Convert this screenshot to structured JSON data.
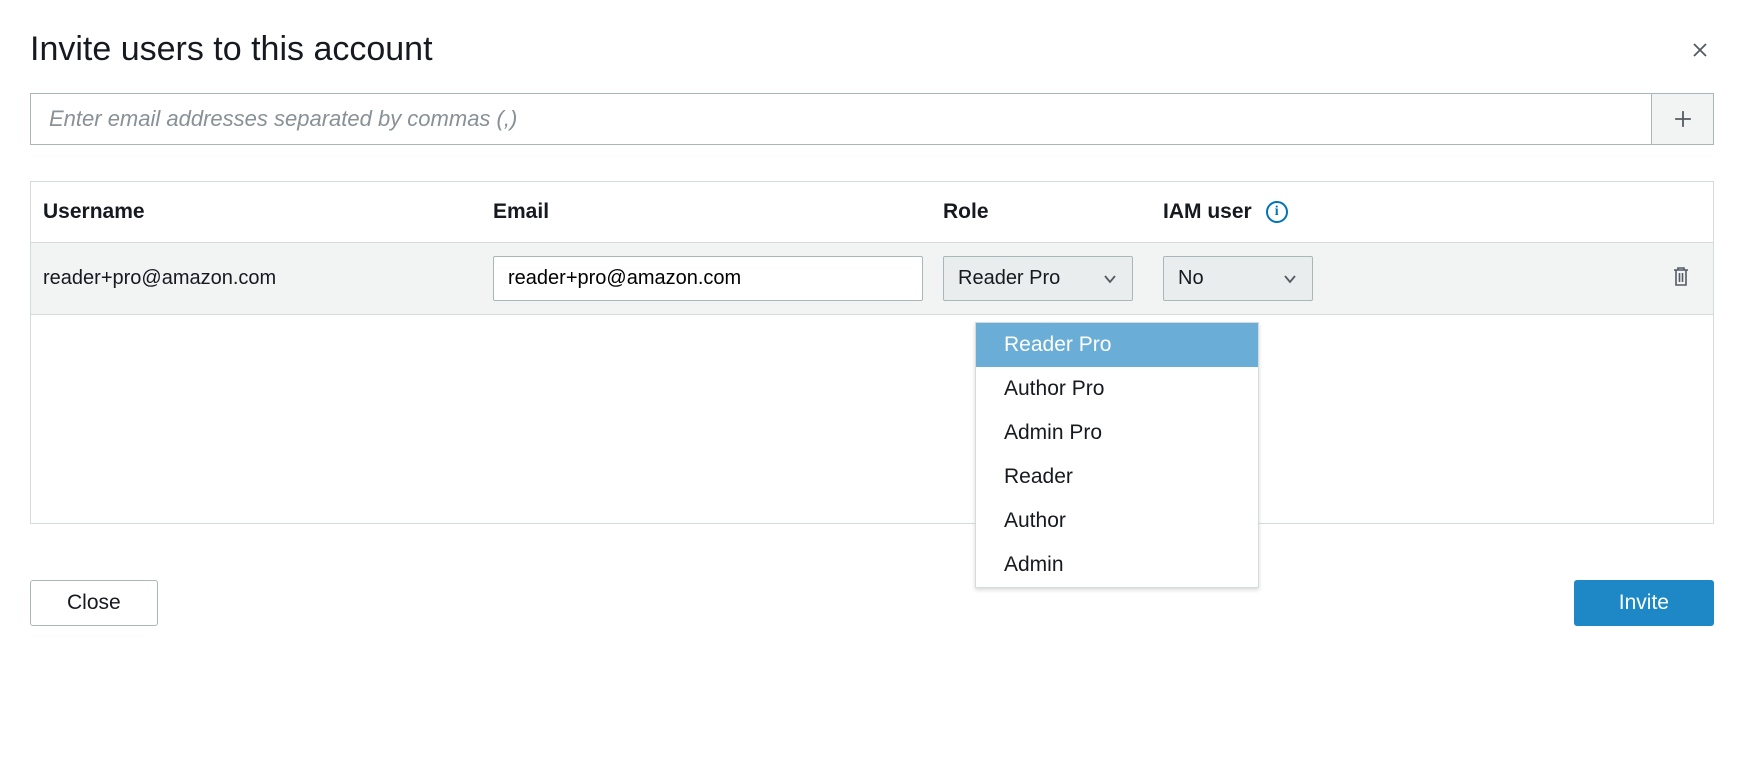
{
  "dialog": {
    "title": "Invite users to this account"
  },
  "email_input": {
    "placeholder": "Enter email addresses separated by commas (,)"
  },
  "table": {
    "headers": {
      "username": "Username",
      "email": "Email",
      "role": "Role",
      "iam": "IAM user"
    },
    "rows": [
      {
        "username": "reader+pro@amazon.com",
        "email": "reader+pro@amazon.com",
        "role": "Reader Pro",
        "iam": "No"
      }
    ]
  },
  "role_dropdown": {
    "options": [
      "Reader Pro",
      "Author Pro",
      "Admin Pro",
      "Reader",
      "Author",
      "Admin"
    ],
    "selected": "Reader Pro"
  },
  "buttons": {
    "close": "Close",
    "invite": "Invite"
  },
  "info_glyph": "i"
}
